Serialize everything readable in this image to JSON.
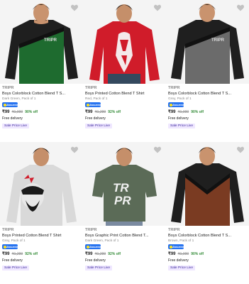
{
  "products": [
    {
      "brand": "TRIPR",
      "title": "Boys Colorblock Cotton Blend T S...",
      "meta": "Dark Green, Pack of 1",
      "assured": "Assured",
      "price": "₹99",
      "mrp": "₹1,000",
      "off": "90% off",
      "delivery": "Free delivery",
      "tag": "Sale Price Live",
      "image": "black-green-colorblock-tshirt"
    },
    {
      "brand": "TRIPR",
      "title": "Boys Printed Cotton Blend T Shirt",
      "meta": "Red, Pack of 1",
      "assured": "Assured",
      "price": "₹99",
      "mrp": "₹1,299",
      "off": "92% off",
      "delivery": "Free delivery",
      "tag": "Sale Price Live",
      "image": "red-printed-tshirt"
    },
    {
      "brand": "TRIPR",
      "title": "Boys Colorblock Cotton Blend T S...",
      "meta": "Grey, Pack of 1",
      "assured": "Assured",
      "price": "₹99",
      "mrp": "₹1,000",
      "off": "90% off",
      "delivery": "Free delivery",
      "tag": "Sale Price Live",
      "image": "black-grey-colorblock-tshirt"
    },
    {
      "brand": "TRIPR",
      "title": "Boys Printed Cotton Blend T Shirt",
      "meta": "Grey, Pack of 1",
      "assured": "Assured",
      "price": "₹99",
      "mrp": "₹1,299",
      "off": "92% off",
      "delivery": "Free delivery",
      "tag": "Sale Price Live",
      "image": "grey-printed-tshirt"
    },
    {
      "brand": "TRIPR",
      "title": "Boys Graphic Print Cotton Blend T...",
      "meta": "Dark Green, Pack of 1",
      "assured": "Assured",
      "price": "₹99",
      "mrp": "₹1,299",
      "off": "92% off",
      "delivery": "Free delivery",
      "tag": "Sale Price Live",
      "image": "olive-graphic-tshirt"
    },
    {
      "brand": "TRIPR",
      "title": "Boys Colorblock Cotton Blend T S...",
      "meta": "Brown, Pack of 1",
      "assured": "Assured",
      "price": "₹99",
      "mrp": "₹1,000",
      "off": "90% off",
      "delivery": "Free delivery",
      "tag": "Sale Price Live",
      "image": "black-brown-colorblock-tshirt"
    }
  ],
  "colors": {
    "price_green": "#388e3c",
    "muted": "#878787",
    "assured_blue": "#2874f0",
    "tag_bg": "#efe7ff",
    "tag_text": "#3d2b9e"
  }
}
